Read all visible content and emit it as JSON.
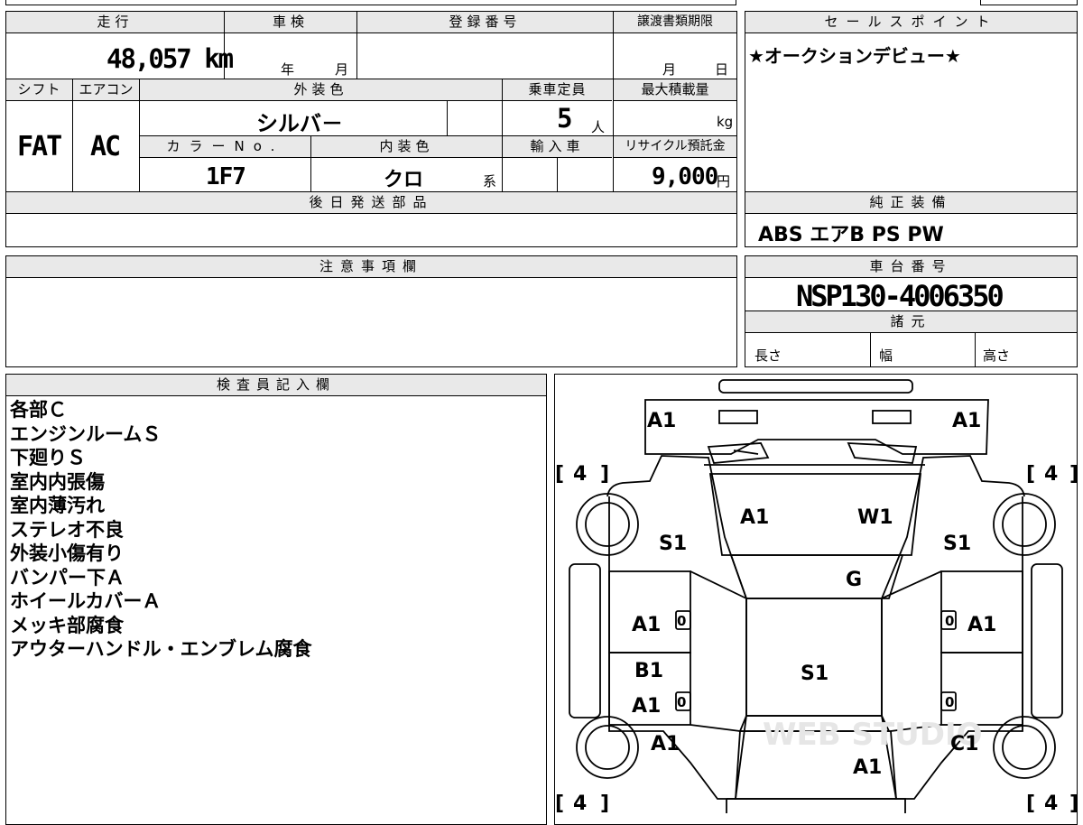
{
  "mileage": {
    "label": "走行",
    "value": "48,057 km"
  },
  "inspection": {
    "label": "車検",
    "year_unit": "年",
    "month_unit": "月"
  },
  "registration": {
    "label": "登録番号"
  },
  "transfer_deadline": {
    "label": "譲渡書類期限",
    "month_unit": "月",
    "day_unit": "日"
  },
  "shift": {
    "label": "シフト",
    "value": "FAT"
  },
  "aircon": {
    "label": "エアコン",
    "value": "AC"
  },
  "exterior_color": {
    "label": "外装色",
    "value": "シルバ－"
  },
  "capacity": {
    "label": "乗車定員",
    "value": "5",
    "unit": "人"
  },
  "max_load": {
    "label": "最大積載量",
    "unit": "kg"
  },
  "color_no": {
    "label": "カラーNo.",
    "value": "1F7"
  },
  "interior_color": {
    "label": "内装色",
    "value": "クロ",
    "suffix": "系"
  },
  "import": {
    "label": "輸入車"
  },
  "recycle_fee": {
    "label": "リサイクル預託金",
    "value": "9,000",
    "unit": "円"
  },
  "sales_point": {
    "label": "セールスポイント",
    "text": "★オークションデビュー★"
  },
  "later_parts": {
    "label": "後日発送部品"
  },
  "equipment": {
    "label": "純正装備",
    "text": "ABS エアB PS PW"
  },
  "notes": {
    "label": "注意事項欄"
  },
  "chassis": {
    "label": "車台番号",
    "value": "NSP130-4006350"
  },
  "specs": {
    "label": "諸元",
    "length": "長さ",
    "width": "幅",
    "height": "高さ"
  },
  "inspector": {
    "label": "検査員記入欄",
    "lines": [
      "各部Ｃ",
      "エンジンルームＳ",
      "下廻りＳ",
      "室内内張傷",
      "室内薄汚れ",
      "ステレオ不良",
      "外装小傷有り",
      "バンパー下Ａ",
      "ホイールカバーＡ",
      "メッキ部腐食",
      "アウターハンドル・エンブレム腐食"
    ]
  },
  "diagram": {
    "front_left": "A1",
    "front_right": "A1",
    "tire_fl": "4",
    "tire_fr": "4",
    "tire_rl": "4",
    "tire_rr": "4",
    "fender_left": "S1",
    "fender_right": "S1",
    "hood_left": "A1",
    "hood_right": "W1",
    "windshield": "G",
    "door_fl": "A1",
    "door_fr": "A1",
    "door_fl_small": "0",
    "door_fr_small": "0",
    "roof": "S1",
    "door_rl_top": "B1",
    "door_rl": "A1",
    "door_rl_small": "0",
    "door_rr_small": "0",
    "rear_left": "A1",
    "rear_right": "C1",
    "trunk": "A1",
    "watermark": "WEB STUDIO"
  }
}
